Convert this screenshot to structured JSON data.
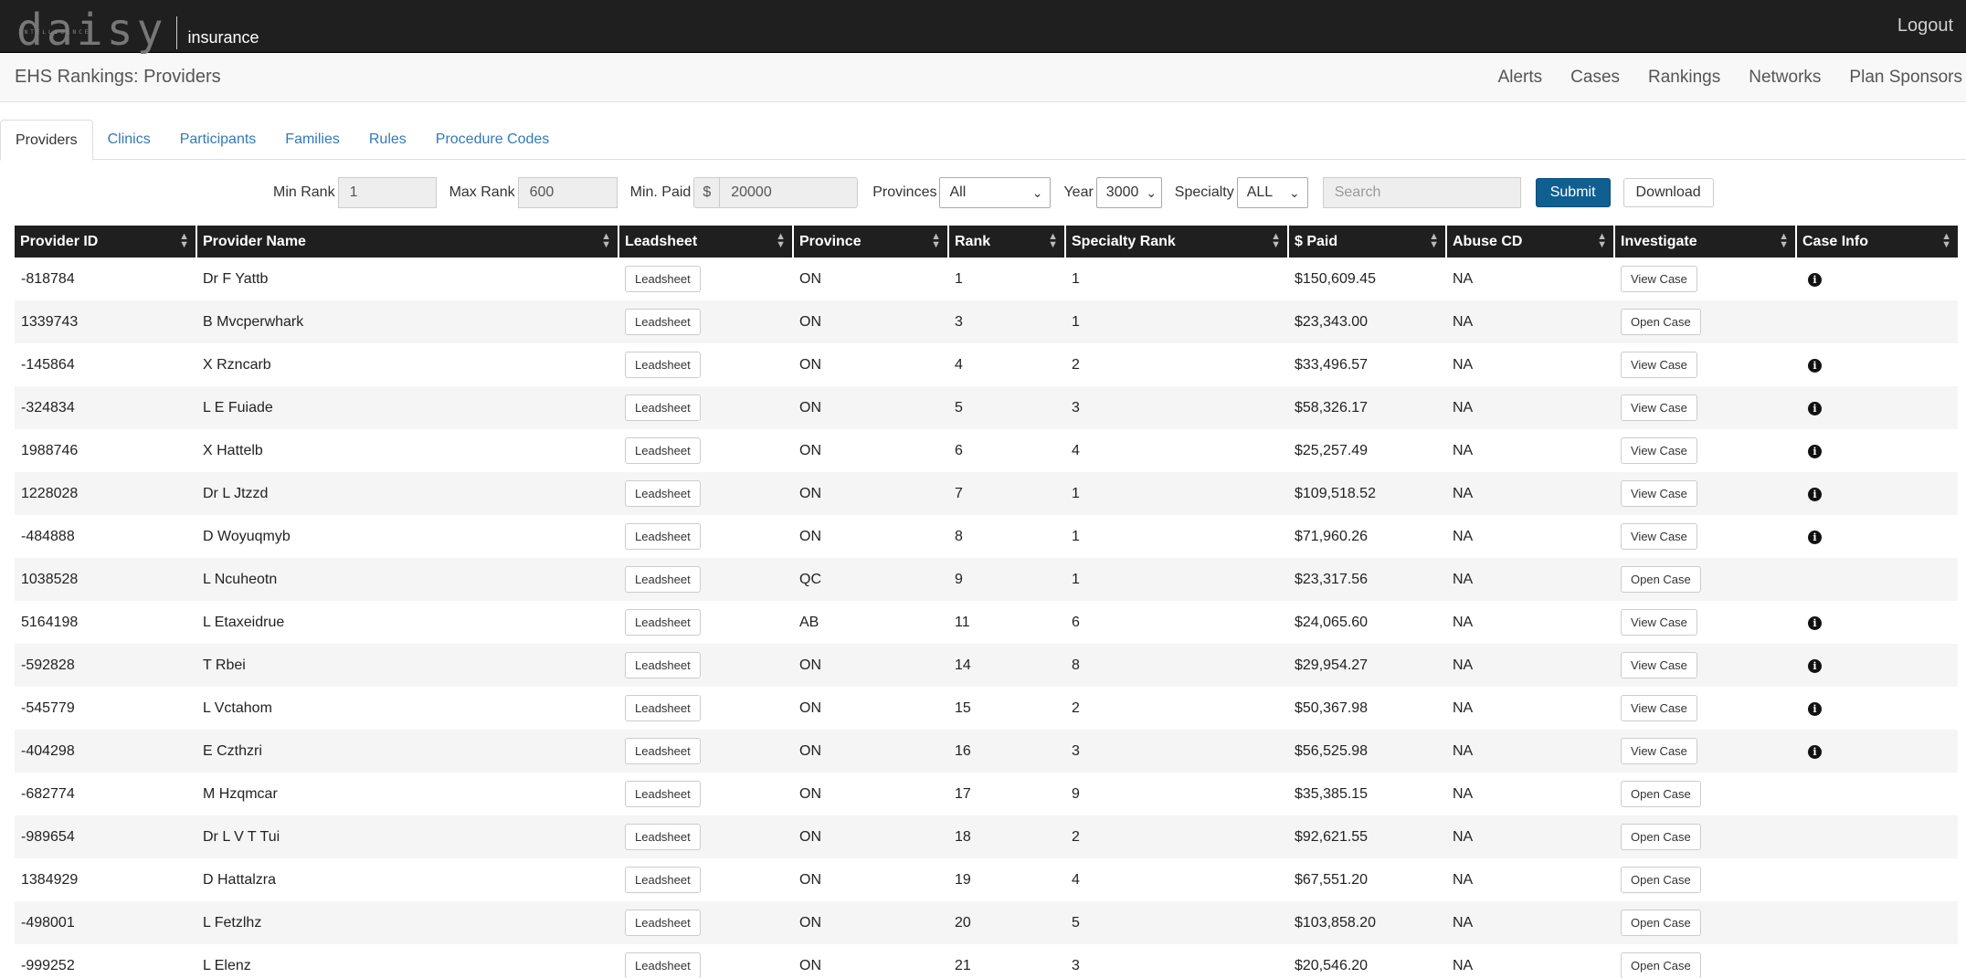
{
  "brand": {
    "logo": "daisy",
    "logo_sub": "INTELLIGENCE",
    "product": "insurance"
  },
  "header": {
    "logout": "Logout"
  },
  "page": {
    "title": "EHS Rankings: Providers"
  },
  "nav": [
    "Alerts",
    "Cases",
    "Rankings",
    "Networks",
    "Plan Sponsors"
  ],
  "tabs": [
    "Providers",
    "Clinics",
    "Participants",
    "Families",
    "Rules",
    "Procedure Codes"
  ],
  "active_tab": "Providers",
  "filters": {
    "min_rank_label": "Min Rank",
    "min_rank": "1",
    "max_rank_label": "Max Rank",
    "max_rank": "600",
    "min_paid_label": "Min. Paid",
    "currency": "$",
    "min_paid": "20000",
    "provinces_label": "Provinces",
    "provinces": "All",
    "year_label": "Year",
    "year": "3000",
    "specialty_label": "Specialty",
    "specialty": "ALL",
    "search_placeholder": "Search",
    "submit": "Submit",
    "download": "Download"
  },
  "table": {
    "columns": [
      "Provider ID",
      "Provider Name",
      "Leadsheet",
      "Province",
      "Rank",
      "Specialty Rank",
      "$ Paid",
      "Abuse CD",
      "Investigate",
      "Case Info"
    ],
    "leadsheet_label": "Leadsheet",
    "rows": [
      {
        "id": "-818784",
        "name": "Dr F Yattb",
        "province": "ON",
        "rank": "1",
        "specialty_rank": "1",
        "paid": "$150,609.45",
        "abuse": "NA",
        "investigate": "View Case",
        "info": true
      },
      {
        "id": "1339743",
        "name": "B Mvcperwhark",
        "province": "ON",
        "rank": "3",
        "specialty_rank": "1",
        "paid": "$23,343.00",
        "abuse": "NA",
        "investigate": "Open Case",
        "info": false
      },
      {
        "id": "-145864",
        "name": "X Rzncarb",
        "province": "ON",
        "rank": "4",
        "specialty_rank": "2",
        "paid": "$33,496.57",
        "abuse": "NA",
        "investigate": "View Case",
        "info": true
      },
      {
        "id": "-324834",
        "name": "L E Fuiade",
        "province": "ON",
        "rank": "5",
        "specialty_rank": "3",
        "paid": "$58,326.17",
        "abuse": "NA",
        "investigate": "View Case",
        "info": true
      },
      {
        "id": "1988746",
        "name": "X Hattelb",
        "province": "ON",
        "rank": "6",
        "specialty_rank": "4",
        "paid": "$25,257.49",
        "abuse": "NA",
        "investigate": "View Case",
        "info": true
      },
      {
        "id": "1228028",
        "name": "Dr L Jtzzd",
        "province": "ON",
        "rank": "7",
        "specialty_rank": "1",
        "paid": "$109,518.52",
        "abuse": "NA",
        "investigate": "View Case",
        "info": true
      },
      {
        "id": "-484888",
        "name": "D Woyuqmyb",
        "province": "ON",
        "rank": "8",
        "specialty_rank": "1",
        "paid": "$71,960.26",
        "abuse": "NA",
        "investigate": "View Case",
        "info": true
      },
      {
        "id": "1038528",
        "name": "L Ncuheotn",
        "province": "QC",
        "rank": "9",
        "specialty_rank": "1",
        "paid": "$23,317.56",
        "abuse": "NA",
        "investigate": "Open Case",
        "info": false
      },
      {
        "id": "5164198",
        "name": "L Etaxeidrue",
        "province": "AB",
        "rank": "11",
        "specialty_rank": "6",
        "paid": "$24,065.60",
        "abuse": "NA",
        "investigate": "View Case",
        "info": true
      },
      {
        "id": "-592828",
        "name": "T Rbei",
        "province": "ON",
        "rank": "14",
        "specialty_rank": "8",
        "paid": "$29,954.27",
        "abuse": "NA",
        "investigate": "View Case",
        "info": true
      },
      {
        "id": "-545779",
        "name": "L Vctahom",
        "province": "ON",
        "rank": "15",
        "specialty_rank": "2",
        "paid": "$50,367.98",
        "abuse": "NA",
        "investigate": "View Case",
        "info": true
      },
      {
        "id": "-404298",
        "name": "E Czthzri",
        "province": "ON",
        "rank": "16",
        "specialty_rank": "3",
        "paid": "$56,525.98",
        "abuse": "NA",
        "investigate": "View Case",
        "info": true
      },
      {
        "id": "-682774",
        "name": "M Hzqmcar",
        "province": "ON",
        "rank": "17",
        "specialty_rank": "9",
        "paid": "$35,385.15",
        "abuse": "NA",
        "investigate": "Open Case",
        "info": false
      },
      {
        "id": "-989654",
        "name": "Dr L V T Tui",
        "province": "ON",
        "rank": "18",
        "specialty_rank": "2",
        "paid": "$92,621.55",
        "abuse": "NA",
        "investigate": "Open Case",
        "info": false
      },
      {
        "id": "1384929",
        "name": "D Hattalzra",
        "province": "ON",
        "rank": "19",
        "specialty_rank": "4",
        "paid": "$67,551.20",
        "abuse": "NA",
        "investigate": "Open Case",
        "info": false
      },
      {
        "id": "-498001",
        "name": "L Fetzlhz",
        "province": "ON",
        "rank": "20",
        "specialty_rank": "5",
        "paid": "$103,858.20",
        "abuse": "NA",
        "investigate": "Open Case",
        "info": false
      },
      {
        "id": "-999252",
        "name": "L Elenz",
        "province": "ON",
        "rank": "21",
        "specialty_rank": "3",
        "paid": "$20,546.20",
        "abuse": "NA",
        "investigate": "Open Case",
        "info": false
      }
    ]
  }
}
